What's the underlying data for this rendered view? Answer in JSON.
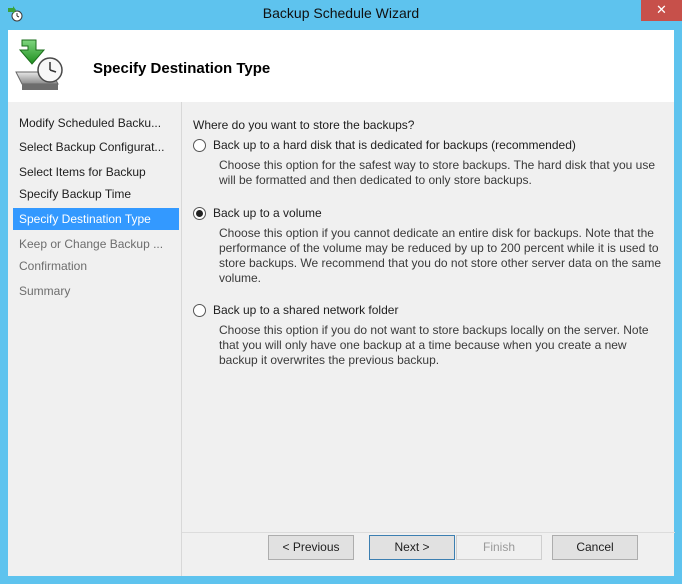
{
  "window": {
    "title": "Backup Schedule Wizard",
    "close_label": "✕",
    "header_title": "Specify Destination Type"
  },
  "sidebar": {
    "items": [
      {
        "label": "Modify Scheduled Backu...",
        "state": "normal"
      },
      {
        "label": "Select Backup Configurat...",
        "state": "normal"
      },
      {
        "label": "Select Items for Backup",
        "state": "normal"
      },
      {
        "label": "Specify Backup Time",
        "state": "normal"
      },
      {
        "label": "Specify Destination Type",
        "state": "active"
      },
      {
        "label": "Keep or Change Backup ...",
        "state": "disabled"
      },
      {
        "label": "Confirmation",
        "state": "disabled"
      },
      {
        "label": "Summary",
        "state": "disabled"
      }
    ]
  },
  "main": {
    "question": "Where do you want to store the backups?",
    "options": [
      {
        "label": "Back up to a hard disk that is dedicated for backups (recommended)",
        "description": "Choose this option for the safest way to store backups. The hard disk that you use will be formatted and then dedicated to only store backups.",
        "selected": false
      },
      {
        "label": "Back up to a volume",
        "description": "Choose this option if you cannot dedicate an entire disk for backups. Note that the performance of the volume may be reduced by up to 200 percent while it is used to store backups. We recommend that you do not store other server data on the same volume.",
        "selected": true
      },
      {
        "label": "Back up to a shared network folder",
        "description": "Choose this option if you do not want to store backups locally on the server. Note that you will only have one backup at a time because when you create a new backup it overwrites the previous backup.",
        "selected": false
      }
    ]
  },
  "buttons": {
    "previous": "< Previous",
    "next": "Next >",
    "finish": "Finish",
    "cancel": "Cancel"
  },
  "colors": {
    "titlebar": "#5ec3ee",
    "active_item": "#3399ff",
    "close_button": "#c7504a"
  }
}
